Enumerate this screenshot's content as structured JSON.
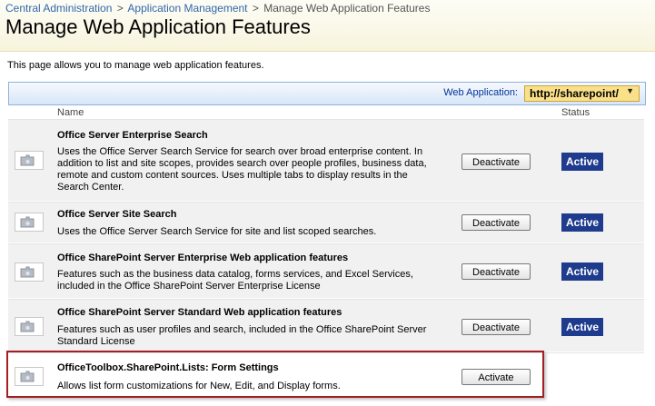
{
  "breadcrumb": {
    "items": [
      "Central Administration",
      "Application Management",
      "Manage Web Application Features"
    ],
    "separator": ">"
  },
  "page": {
    "title": "Manage Web Application Features",
    "description": "This page allows you to manage web application features."
  },
  "toolbar": {
    "web_app_label": "Web Application:",
    "web_app_value": "http://sharepoint/"
  },
  "columns": {
    "name": "Name",
    "status": "Status"
  },
  "features": [
    {
      "name": "Office Server Enterprise Search",
      "description": "Uses the Office Server Search Service for search over broad enterprise content. In addition to list and site scopes, provides search over people profiles, business data, remote and custom content sources. Uses multiple tabs to display results in the Search Center.",
      "button": "Deactivate",
      "status": "Active"
    },
    {
      "name": "Office Server Site Search",
      "description": "Uses the Office Server Search Service for site and list scoped searches.",
      "button": "Deactivate",
      "status": "Active"
    },
    {
      "name": "Office SharePoint Server Enterprise Web application features",
      "description": "Features such as the business data catalog, forms services, and Excel Services, included in the Office SharePoint Server Enterprise License",
      "button": "Deactivate",
      "status": "Active"
    },
    {
      "name": "Office SharePoint Server Standard Web application features",
      "description": "Features such as user profiles and search, included in the Office SharePoint Server Standard License",
      "button": "Deactivate",
      "status": "Active"
    },
    {
      "name": "OfficeToolbox.SharePoint.Lists: Form Settings",
      "description": "Allows list form customizations for New, Edit, and Display forms.",
      "button": "Activate",
      "status": ""
    }
  ],
  "colors": {
    "status_active": "#1e3b8e",
    "highlight_border": "#a31f24",
    "link": "#3366aa"
  },
  "icons": {
    "feature": "puzzle-feature-icon",
    "dropdown": "chevron-down-icon"
  }
}
